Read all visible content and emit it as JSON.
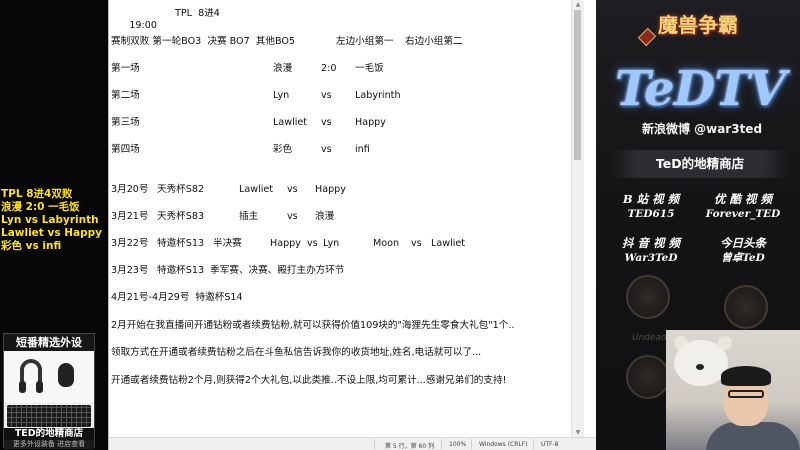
{
  "left_overlay": {
    "notes": [
      "TPL 8进4双败",
      "浪漫 2:0 一毛饭",
      "Lyn vs Labyrinth",
      "Lawliet vs Happy",
      "彩色 vs infi"
    ],
    "promo": {
      "title": "短番精选外设",
      "shop": "TED的地精商店",
      "sub": "更多外设装备 进店查看"
    }
  },
  "notepad": {
    "line1": {
      "time": "19:00",
      "event": "TPL  8进4"
    },
    "line2": {
      "format": "赛制双败 第一轮BO3  决赛 BO7  其他BO5",
      "left": "左边小组第一",
      "right": "右边小组第二"
    },
    "matches": [
      {
        "label": "第一场",
        "p1": "浪漫",
        "mid": "2:0",
        "p2": "一毛饭"
      },
      {
        "label": "第二场",
        "p1": "Lyn",
        "mid": "vs",
        "p2": "Labyrinth"
      },
      {
        "label": "第三场",
        "p1": "Lawliet",
        "mid": "vs",
        "p2": "Happy"
      },
      {
        "label": "第四场",
        "p1": "彩色",
        "mid": "vs",
        "p2": "infi"
      }
    ],
    "schedule": [
      {
        "date": "3月20号",
        "event": "天秀杯S82",
        "p1": "Lawliet",
        "vs": "vs",
        "p2": "Happy"
      },
      {
        "date": "3月21号",
        "event": "天秀杯S83",
        "p1": "插主",
        "vs": "vs",
        "p2": "浪漫"
      },
      {
        "date": "3月22号",
        "event": "特邀杯S13",
        "round": "半决赛",
        "a1": "Happy",
        "avs": "vs",
        "a2": "Lyn",
        "b1": "Moon",
        "bvs": "vs",
        "b2": "Lawliet"
      },
      {
        "date": "3月23号",
        "text": "特邀杯S13  季军赛、决赛、殿打主办方环节"
      }
    ],
    "s14": "4月21号-4月29号  特邀杯S14",
    "notice1": "2月开始在我直播间开通钻粉或者续费钻粉,就可以获得价值109块的\"海狸先生零食大礼包\"1个..",
    "notice2": "领取方式在开通或者续费钻粉之后在斗鱼私信告诉我你的收货地址,姓名,电话就可以了...",
    "notice3": "开通或者续费钻粉2个月,则获得2个大礼包,以此类推..不设上限,均可累计...感谢兄弟们的支持!",
    "status": {
      "position": "第 5 行，第 60 列",
      "zoom": "100%",
      "line_ending": "Windows (CRLF)",
      "encoding": "UTF-8"
    }
  },
  "right_overlay": {
    "game_title": "魔兽争霸",
    "logo_text": "TeDTV",
    "weibo": "新浪微博 @war3ted",
    "shop_header": "TeD的地精商店",
    "socials": [
      {
        "name": "B 站 视 频",
        "id": "TED615"
      },
      {
        "name": "优 酷 视 频",
        "id": "Forever_TED"
      },
      {
        "name": "抖 音 视 频",
        "id": "War3TeD"
      },
      {
        "name": "今日头条",
        "id": "曾卓TeD"
      }
    ],
    "emblem_caption": "Undead"
  }
}
